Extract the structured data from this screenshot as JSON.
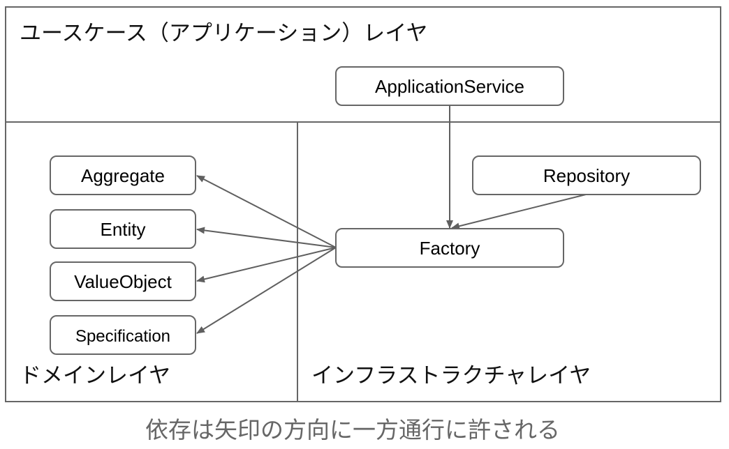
{
  "layers": {
    "usecase": "ユースケース（アプリケーション）レイヤ",
    "domain": "ドメインレイヤ",
    "infrastructure": "インフラストラクチャレイヤ"
  },
  "nodes": {
    "application_service": "ApplicationService",
    "repository": "Repository",
    "factory": "Factory",
    "aggregate": "Aggregate",
    "entity": "Entity",
    "value_object": "ValueObject",
    "specification": "Specification"
  },
  "edges": [
    {
      "from": "application_service",
      "to": "factory"
    },
    {
      "from": "repository",
      "to": "factory"
    },
    {
      "from": "factory",
      "to": "aggregate"
    },
    {
      "from": "factory",
      "to": "entity"
    },
    {
      "from": "factory",
      "to": "value_object"
    },
    {
      "from": "factory",
      "to": "specification"
    }
  ],
  "caption": "依存は矢印の方向に一方通行に許される",
  "colors": {
    "line": "#666666",
    "caption": "#666666",
    "text": "#000000"
  }
}
